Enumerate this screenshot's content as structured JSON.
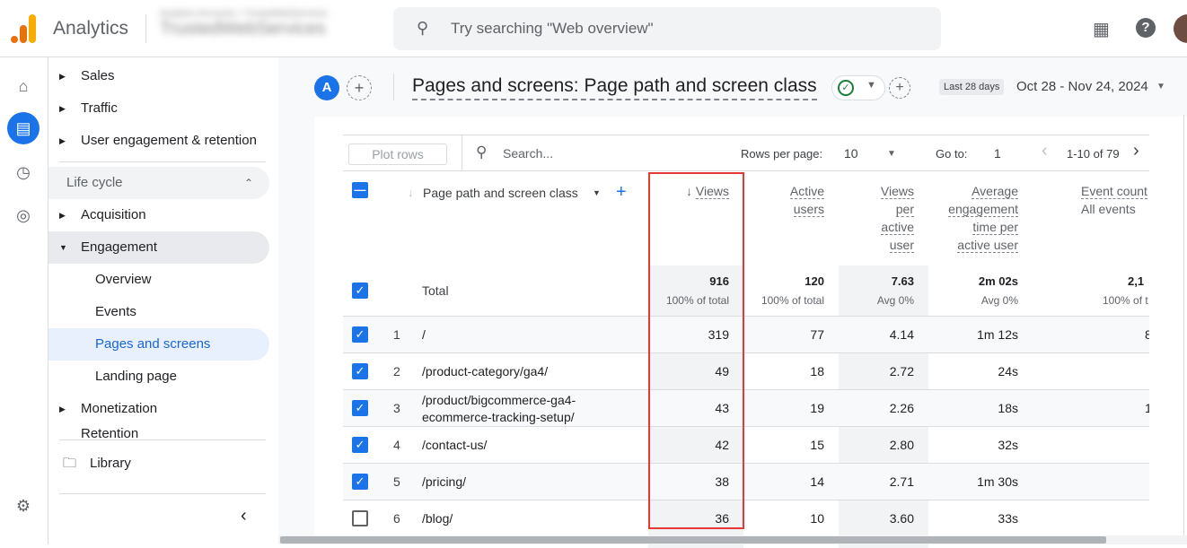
{
  "app": {
    "name": "Analytics",
    "account_blurred": "Analytics Accounts > TrustedWebServices",
    "account_name": "TrustedWebServices"
  },
  "search": {
    "placeholder": "Try searching \"Web overview\""
  },
  "nav": {
    "items": [
      {
        "label": "Sales"
      },
      {
        "label": "Traffic"
      },
      {
        "label": "User engagement & retention"
      }
    ],
    "lifecycle": "Life cycle",
    "lc_items": [
      {
        "label": "Acquisition"
      },
      {
        "label": "Engagement"
      },
      {
        "label": "Overview"
      },
      {
        "label": "Events"
      },
      {
        "label": "Pages and screens"
      },
      {
        "label": "Landing page"
      },
      {
        "label": "Monetization"
      },
      {
        "label": "Retention"
      }
    ],
    "library": "Library"
  },
  "report": {
    "avatar": "A",
    "title": "Pages and screens: Page path and screen class",
    "date_label": "Last 28 days",
    "date_range": "Oct 28 - Nov 24, 2024"
  },
  "toolbar": {
    "plot_rows": "Plot rows",
    "search_placeholder": "Search...",
    "rows_per_page_label": "Rows per page:",
    "rows_per_page": "10",
    "goto_label": "Go to:",
    "goto": "1",
    "pagination": "1-10 of 79"
  },
  "table": {
    "dimension_header": "Page path and screen class",
    "headers": {
      "views": "Views",
      "active_users": [
        "Active",
        "users"
      ],
      "views_per_user": [
        "Views",
        "per",
        "active",
        "user"
      ],
      "avg_eng": [
        "Average",
        "engagement",
        "time per",
        "active user"
      ],
      "event_count": "Event count",
      "event_sub": "All events"
    },
    "total": {
      "label": "Total",
      "views": "916",
      "views_sub": "100% of total",
      "active_users": "120",
      "active_users_sub": "100% of total",
      "vpu": "7.63",
      "vpu_sub": "Avg 0%",
      "avg_eng": "2m 02s",
      "avg_eng_sub": "Avg 0%",
      "event_count": "2,1",
      "event_sub": "100% of t"
    },
    "rows": [
      {
        "idx": "1",
        "path": "/",
        "views": "319",
        "users": "77",
        "vpu": "4.14",
        "eng": "1m 12s",
        "events": "8",
        "checked": true
      },
      {
        "idx": "2",
        "path": "/product-category/ga4/",
        "views": "49",
        "users": "18",
        "vpu": "2.72",
        "eng": "24s",
        "events": "",
        "checked": true
      },
      {
        "idx": "3",
        "path": "/product/bigcommerce-ga4-ecommerce-tracking-setup/",
        "views": "43",
        "users": "19",
        "vpu": "2.26",
        "eng": "18s",
        "events": "1",
        "checked": true
      },
      {
        "idx": "4",
        "path": "/contact-us/",
        "views": "42",
        "users": "15",
        "vpu": "2.80",
        "eng": "32s",
        "events": "",
        "checked": true
      },
      {
        "idx": "5",
        "path": "/pricing/",
        "views": "38",
        "users": "14",
        "vpu": "2.71",
        "eng": "1m 30s",
        "events": "",
        "checked": true
      },
      {
        "idx": "6",
        "path": "/blog/",
        "views": "36",
        "users": "10",
        "vpu": "3.60",
        "eng": "33s",
        "events": "",
        "checked": false
      }
    ]
  },
  "colors": {
    "accent": "#1a73e8",
    "highlight_box": "#e53935",
    "logo": [
      "#e8710a",
      "#f9ab00"
    ]
  }
}
